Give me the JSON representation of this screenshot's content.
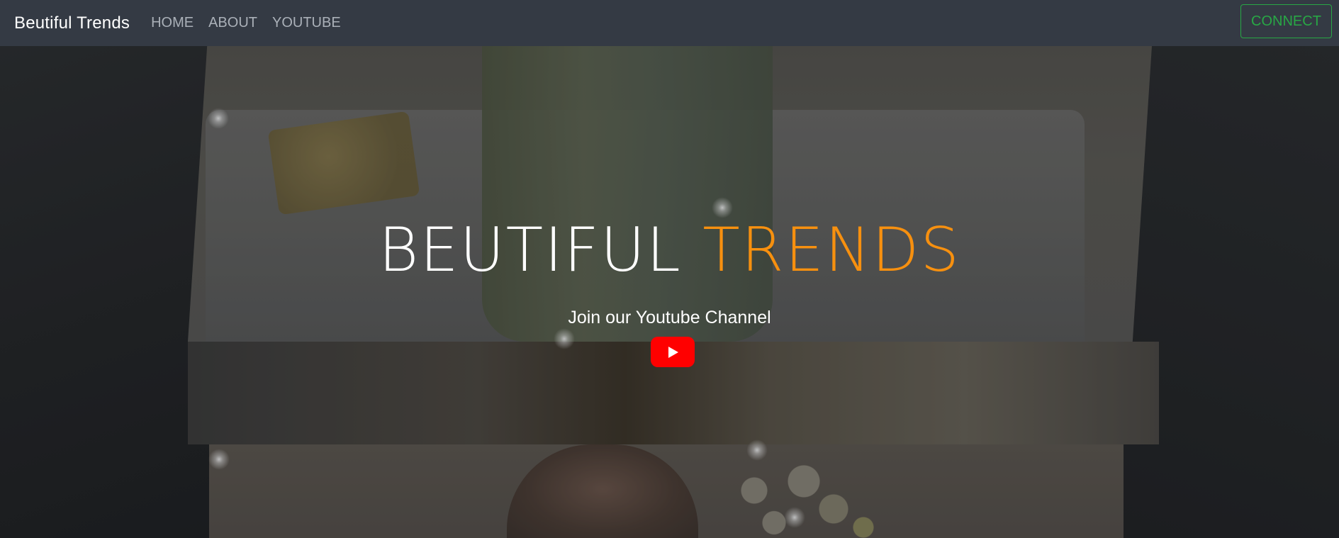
{
  "navbar": {
    "brand": "Beutiful Trends",
    "links": [
      {
        "label": "HOME"
      },
      {
        "label": "ABOUT"
      },
      {
        "label": "YOUTUBE"
      }
    ],
    "connect_label": "CONNECT"
  },
  "hero": {
    "title_part1": "BEUTIFUL",
    "title_part2": "TRENDS",
    "subtitle": "Join our Youtube Channel",
    "youtube_icon": "youtube-play-icon"
  },
  "colors": {
    "navbar_bg": "#343a44",
    "accent_orange": "#f7900f",
    "connect_green": "#28a745",
    "youtube_red": "#ff0000"
  }
}
